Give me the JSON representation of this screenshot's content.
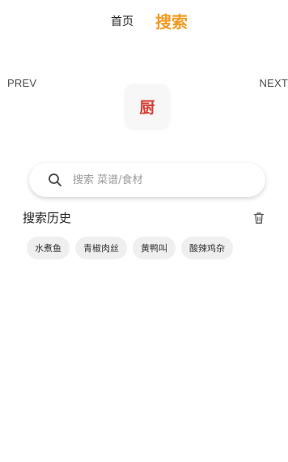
{
  "tabs": {
    "home": "首页",
    "search": "搜索",
    "active_color": "#f39a1e"
  },
  "nav": {
    "prev": "PREV",
    "next": "NEXT"
  },
  "logo": {
    "glyph": "厨",
    "icon": "kitchen-logo-icon",
    "color": "#d63a2f"
  },
  "search": {
    "placeholder": "搜索 菜谱/食材",
    "value": "",
    "icon": "search-icon"
  },
  "history": {
    "title": "搜索历史",
    "clear_icon": "trash-icon",
    "items": [
      {
        "label": "水煮鱼"
      },
      {
        "label": "青椒肉丝"
      },
      {
        "label": "黄鸭叫"
      },
      {
        "label": "酸辣鸡杂"
      }
    ]
  }
}
